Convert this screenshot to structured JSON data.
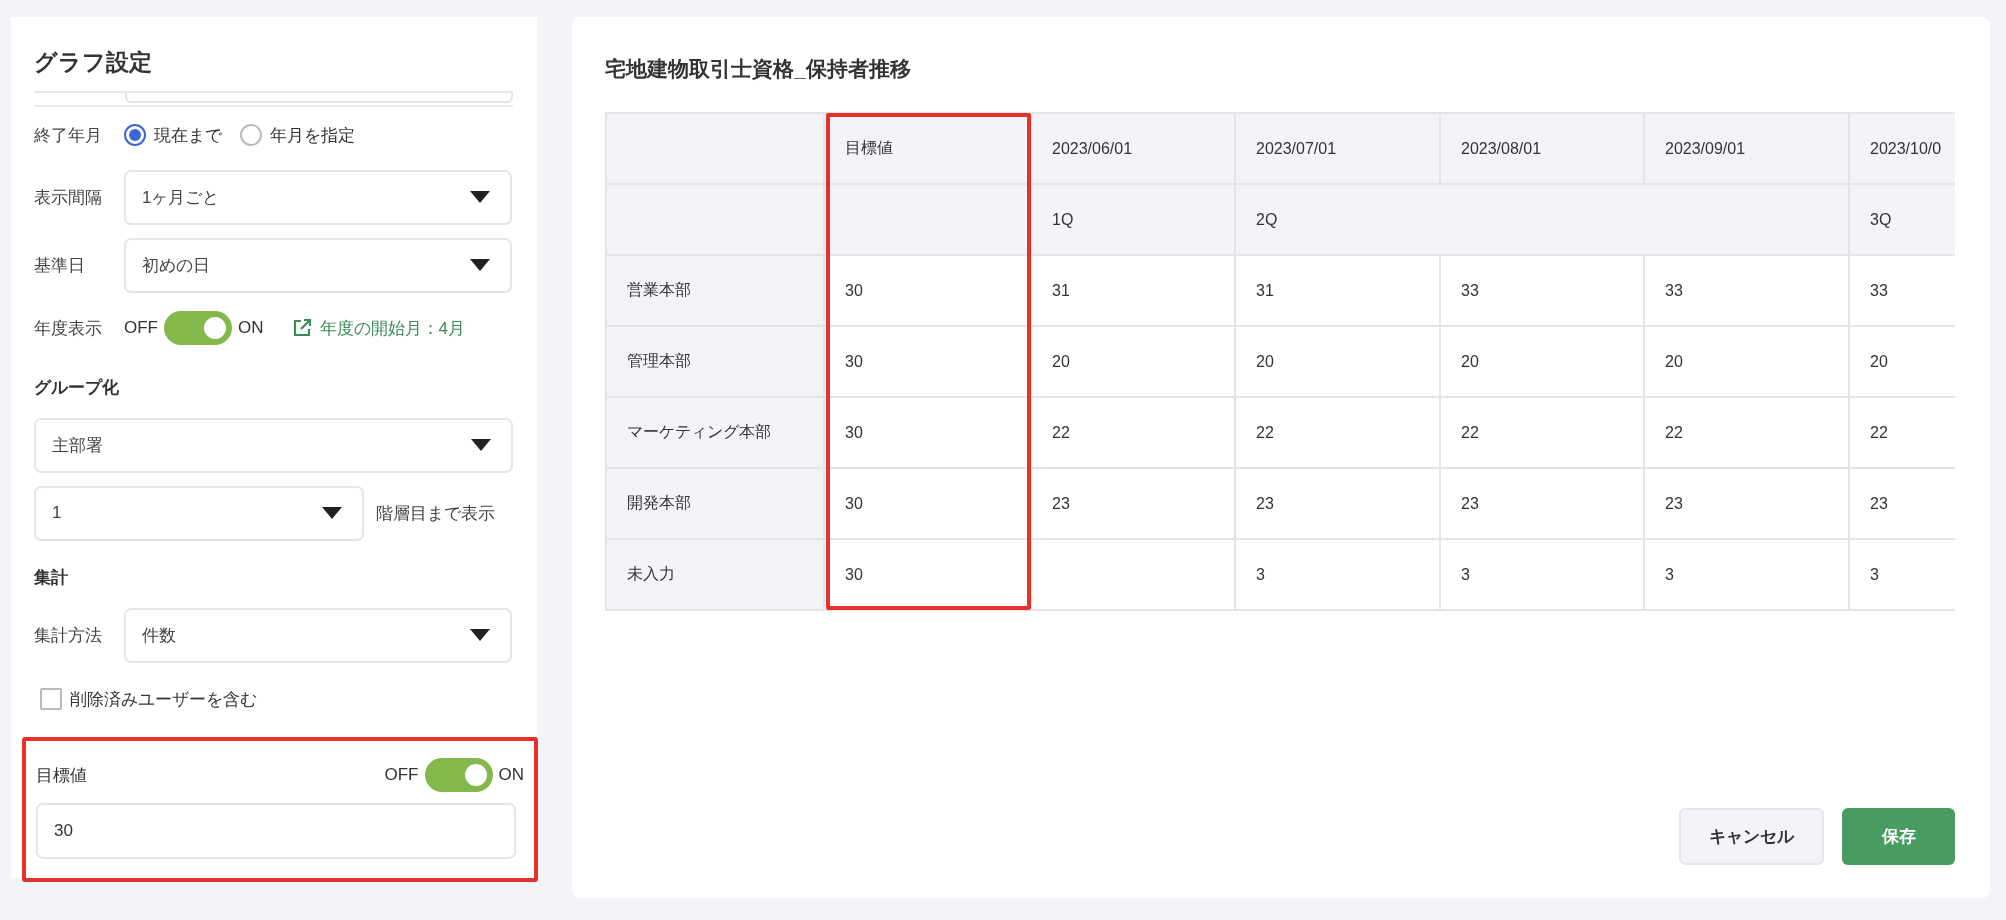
{
  "settings": {
    "title": "グラフ設定",
    "items": [
      {
        "kind": "clipped_field"
      },
      {
        "kind": "radio",
        "label": "終了年月",
        "options": [
          {
            "label": "現在まで",
            "selected": true
          },
          {
            "label": "年月を指定",
            "selected": false
          }
        ]
      },
      {
        "kind": "select",
        "label": "表示間隔",
        "value": "1ヶ月ごと"
      },
      {
        "kind": "select",
        "label": "基準日",
        "value": "初めの日"
      },
      {
        "kind": "toggle",
        "label": "年度表示",
        "off_label": "OFF",
        "on_label": "ON",
        "on": true,
        "link": "年度の開始月：4月"
      },
      {
        "kind": "heading",
        "label": "グループ化"
      },
      {
        "kind": "select_full",
        "value": "主部署"
      },
      {
        "kind": "select_suffix",
        "value": "1",
        "suffix": "階層目まで表示"
      },
      {
        "kind": "heading",
        "label": "集計"
      },
      {
        "kind": "select",
        "label": "集計方法",
        "value": "件数"
      },
      {
        "kind": "checkbox",
        "label": "削除済みユーザーを含む",
        "checked": false
      }
    ],
    "target": {
      "label": "目標値",
      "off_label": "OFF",
      "on_label": "ON",
      "on": true,
      "value": "30"
    }
  },
  "chart_table": {
    "title": "宅地建物取引士資格_保持者推移",
    "target_column": "目標値",
    "columns": [
      {
        "date": "2023/06/01",
        "quarter": "1Q"
      },
      {
        "date": "2023/07/01",
        "quarter": "2Q"
      },
      {
        "date": "2023/08/01"
      },
      {
        "date": "2023/09/01"
      },
      {
        "date": "2023/10/0",
        "quarter": "3Q"
      }
    ],
    "rows": [
      {
        "name": "営業本部",
        "target": "30",
        "cells": [
          {
            "kind": "value",
            "text": "31"
          },
          {
            "kind": "value",
            "text": "31"
          },
          {
            "kind": "value",
            "text": "33"
          },
          {
            "kind": "value",
            "text": "33"
          },
          {
            "kind": "value",
            "text": "33"
          }
        ]
      },
      {
        "name": "管理本部",
        "target": "30",
        "cells": [
          {
            "kind": "value",
            "text": "20"
          },
          {
            "kind": "value",
            "text": "20"
          },
          {
            "kind": "value",
            "text": "20"
          },
          {
            "kind": "value",
            "text": "20"
          },
          {
            "kind": "value",
            "text": "20"
          }
        ]
      },
      {
        "name": "マーケティング本部",
        "target": "30",
        "cells": [
          {
            "kind": "value",
            "text": "22"
          },
          {
            "kind": "value",
            "text": "22"
          },
          {
            "kind": "value",
            "text": "22"
          },
          {
            "kind": "value",
            "text": "22"
          },
          {
            "kind": "value",
            "text": "22"
          }
        ]
      },
      {
        "name": "開発本部",
        "target": "30",
        "cells": [
          {
            "kind": "value",
            "text": "23"
          },
          {
            "kind": "value",
            "text": "23"
          },
          {
            "kind": "value",
            "text": "23"
          },
          {
            "kind": "value",
            "text": "23"
          },
          {
            "kind": "value",
            "text": "23"
          }
        ]
      },
      {
        "name": "未入力",
        "target": "30",
        "cells": [
          {
            "kind": "empty"
          },
          {
            "kind": "value",
            "text": "3"
          },
          {
            "kind": "value",
            "text": "3"
          },
          {
            "kind": "value",
            "text": "3"
          },
          {
            "kind": "value",
            "text": "3"
          }
        ]
      }
    ]
  },
  "buttons": {
    "cancel": "キャンセル",
    "save": "保存"
  }
}
